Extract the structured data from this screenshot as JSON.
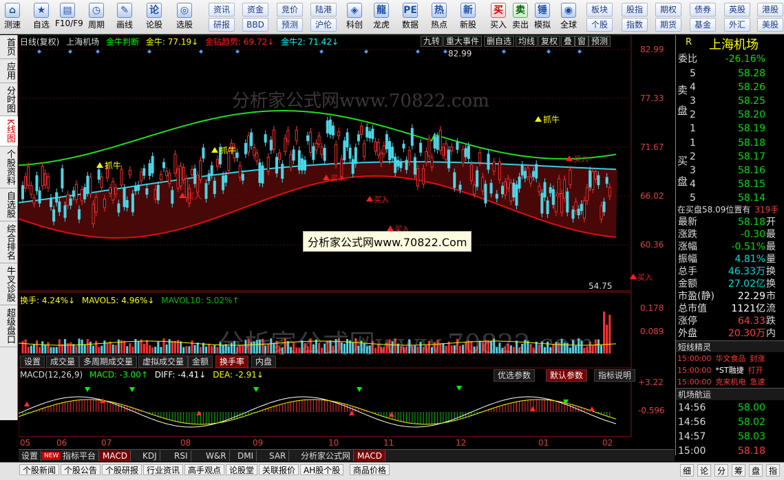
{
  "toolbar": {
    "big_buttons": [
      {
        "label": "测速",
        "glyph": "⌂"
      },
      {
        "label": "自选",
        "glyph": "★"
      },
      {
        "label": "F10/F9",
        "glyph": "▤"
      },
      {
        "label": "周期",
        "glyph": "◷"
      },
      {
        "label": "画线",
        "glyph": "✎"
      },
      {
        "label": "论股",
        "glyph": "论"
      },
      {
        "label": "选股",
        "glyph": "◎"
      },
      {
        "label": "科创",
        "glyph": "◈"
      },
      {
        "label": "龙虎",
        "glyph": "龍"
      },
      {
        "label": "数据",
        "glyph": "PE"
      },
      {
        "label": "热点",
        "glyph": "热"
      },
      {
        "label": "新股",
        "glyph": "新"
      },
      {
        "label": "买入",
        "glyph": "买"
      },
      {
        "label": "卖出",
        "glyph": "卖"
      },
      {
        "label": "模拟",
        "glyph": "锤"
      },
      {
        "label": "全球",
        "glyph": "◉"
      }
    ],
    "small_buttons": [
      {
        "label": "资讯"
      },
      {
        "label": "资金"
      },
      {
        "label": "竞价"
      },
      {
        "label": "陆港"
      },
      {
        "label": "研报"
      },
      {
        "label": "BBD"
      },
      {
        "label": "预测"
      },
      {
        "label": "沪伦"
      },
      {
        "label": "板块"
      },
      {
        "label": "股指"
      },
      {
        "label": "期权"
      },
      {
        "label": "债券"
      },
      {
        "label": "英股"
      },
      {
        "label": "港股"
      },
      {
        "label": "个股"
      },
      {
        "label": "指数"
      },
      {
        "label": "期货"
      },
      {
        "label": "基金"
      },
      {
        "label": "外汇"
      },
      {
        "label": "美股"
      }
    ]
  },
  "left_tabs": [
    "首页",
    "应用",
    "分时图",
    "K线图",
    "个股资料",
    "自选股",
    "综合排名",
    "牛叉诊股",
    "超级盘口"
  ],
  "chart": {
    "header": {
      "mode": "日线(复权)",
      "name": "上海机场",
      "ind1": "金牛判断",
      "ind2": "金牛: 77.19↓",
      "ind3": "金钻趋势: 69.72↓",
      "ind4": "金牛2: 71.42↓"
    },
    "top_tabs": [
      "九转",
      "重大事件",
      "删自选",
      "均线",
      "复权",
      "叠",
      "窗",
      "预测"
    ],
    "price_axis": [
      "82.99",
      "77.33",
      "71.67",
      "66.02",
      "60.36"
    ],
    "price_high_label": "82.99",
    "price_low_label": "54.75",
    "signals": {
      "buy": "买入",
      "grab": "抓牛"
    },
    "watermark_center": "分析家公式网www.70822.Com",
    "watermark_big": "分析家公式网www.70822.com",
    "watermark_top": "分析家公式网www.70822.com",
    "vol_header": {
      "a": "换手: 4.24%↓",
      "b": "MAVOL5: 4.96%↓",
      "c": "MAVOL10: 5.02%↑"
    },
    "vol_axis": [
      "0.178",
      "0.089"
    ],
    "vol_tabs": [
      "设置",
      "成交量",
      "多周期成交量",
      "虚拟成交量",
      "金额",
      "换手率",
      "内盘"
    ],
    "macd_header": {
      "a": "MACD(12,26,9)",
      "b": "MACD: -3.00↑",
      "c": "DIFF: -4.41↓",
      "d": "DEA: -2.91↓"
    },
    "macd_tabs": [
      "优选参数",
      "默认参数",
      "指标说明"
    ],
    "macd_axis": [
      "+3.22",
      "-0.596"
    ],
    "dates": [
      "05",
      "06",
      "07",
      "08",
      "09",
      "10",
      "11",
      "12",
      "01",
      "02"
    ]
  },
  "chart_data": {
    "type": "candlestick",
    "title": "上海机场 日线(复权)",
    "ylim": [
      54.75,
      82.99
    ],
    "y_ticks": [
      82.99,
      77.33,
      71.67,
      66.02,
      60.36
    ],
    "x_ticks": [
      "05",
      "06",
      "07",
      "08",
      "09",
      "10",
      "11",
      "12",
      "01",
      "02"
    ],
    "series": [
      {
        "name": "金牛",
        "last": 77.19
      },
      {
        "name": "金钻趋势",
        "last": 69.72
      },
      {
        "name": "金牛2",
        "last": 71.42
      }
    ],
    "turnover": {
      "换手": 4.24,
      "MAVOL5": 4.96,
      "MAVOL10": 5.02,
      "ylim": [
        0,
        0.178
      ]
    },
    "macd": {
      "MACD": -3.0,
      "DIFF": -4.41,
      "DEA": -2.91,
      "axis": [
        3.22,
        -0.596
      ]
    }
  },
  "bottom_tabs1": [
    "设置",
    "NEW",
    "指标平台",
    "MACD",
    "KDJ",
    "RSI",
    "W&R",
    "DMI",
    "SAR",
    "分析家公式网",
    "MACD"
  ],
  "bottom_tabs2": [
    "个股新闻",
    "个股公告",
    "个股研报",
    "行业资讯",
    "高手观点",
    "论股堂",
    "关联报价",
    "AH股个股",
    "商品价格"
  ],
  "right_tabs2": [
    "细",
    "论",
    "分",
    "筹",
    "盘",
    "指"
  ],
  "right_panel": {
    "code_flag": "R",
    "title": "上海机场",
    "wei_bi_label": "委比",
    "wei_bi": "-26.16%",
    "sell_label": "卖盘",
    "buy_label": "买盘",
    "asks": [
      {
        "lvl": "5",
        "price": "58.28"
      },
      {
        "lvl": "4",
        "price": "58.26"
      },
      {
        "lvl": "3",
        "price": "58.25"
      },
      {
        "lvl": "2",
        "price": "58.20"
      },
      {
        "lvl": "1",
        "price": "58.19"
      }
    ],
    "bids": [
      {
        "lvl": "1",
        "price": "58.18"
      },
      {
        "lvl": "2",
        "price": "58.17"
      },
      {
        "lvl": "3",
        "price": "58.16"
      },
      {
        "lvl": "4",
        "price": "58.15"
      },
      {
        "lvl": "5",
        "price": "58.14"
      }
    ],
    "note": "在买盘58.09位置有",
    "note_val": "319手",
    "stats": [
      {
        "label": "最新",
        "value": "58.18",
        "extra": "开",
        "color": "grn"
      },
      {
        "label": "涨跌",
        "value": "-0.30",
        "extra": "最",
        "color": "grn"
      },
      {
        "label": "涨幅",
        "value": "-0.51%",
        "extra": "最",
        "color": "grn"
      },
      {
        "label": "振幅",
        "value": "4.81%",
        "extra": "量",
        "color": "cyan"
      },
      {
        "label": "总手",
        "value": "46.33万",
        "extra": "换",
        "color": "cyan"
      },
      {
        "label": "金额",
        "value": "27.02亿",
        "extra": "换",
        "color": "cyan"
      },
      {
        "label": "市盈(静)",
        "value": "22.29",
        "extra": "市",
        "color": "wht"
      },
      {
        "label": "总市值",
        "value": "1121亿",
        "extra": "流",
        "color": "wht"
      },
      {
        "label": "涨停",
        "value": "64.33",
        "extra": "跌",
        "color": "red"
      },
      {
        "label": "外盘",
        "value": "20.30万",
        "extra": "内",
        "color": "red"
      }
    ],
    "short_title": "短线精灵",
    "short_items": [
      {
        "time": "15:00:00",
        "name": "华文食品",
        "tag": "封涨"
      },
      {
        "time": "15:00:00",
        "name": "*ST融捷",
        "tag": "打开"
      },
      {
        "time": "15:00:00",
        "name": "克来机电",
        "tag": "急速"
      }
    ],
    "flow_title": "机场航运",
    "ticks": [
      {
        "time": "14:56",
        "price": "58.00"
      },
      {
        "time": "14:56",
        "price": "58.02"
      },
      {
        "time": "14:57",
        "price": "58.03"
      },
      {
        "time": "15:00",
        "price": "58.18"
      }
    ]
  }
}
